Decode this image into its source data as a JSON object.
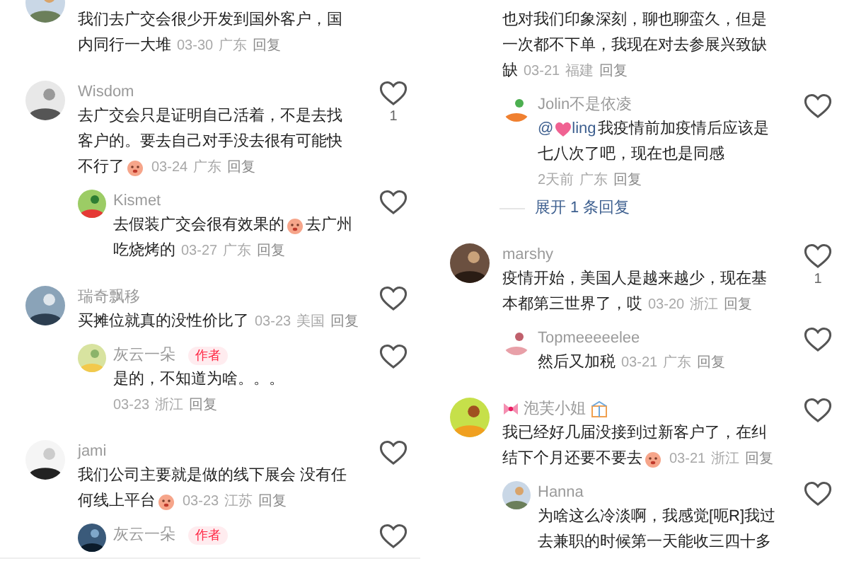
{
  "columns": [
    {
      "divider_at_end": true,
      "comments": [
        {
          "avatar": {
            "kind": "picture"
          },
          "lines": [
            [
              {
                "kind": "text",
                "text": "我们去广交会很少开发到国外客户，国"
              }
            ],
            [
              {
                "kind": "text",
                "text": "内同行一大堆"
              }
            ]
          ],
          "date": "03-30",
          "location": "广东",
          "reply": "回复"
        },
        {
          "avatar": {
            "kind": "picture"
          },
          "name": "Wisdom",
          "lines": [
            [
              {
                "kind": "text",
                "text": "去广交会只是证明自己活着，不是去找"
              }
            ],
            [
              {
                "kind": "text",
                "text": "客户的。要去自己对手没去很有可能快"
              }
            ],
            [
              {
                "kind": "text",
                "text": "不行了"
              },
              {
                "kind": "emoji"
              }
            ]
          ],
          "date": "03-24",
          "location": "广东",
          "reply": "回复",
          "liked": false,
          "likes": "1",
          "replies": [
            {
              "avatar": {
                "kind": "picture"
              },
              "name": "Kismet",
              "lines": [
                [
                  {
                    "kind": "text",
                    "text": "去假装广交会很有效果的"
                  },
                  {
                    "kind": "emoji"
                  },
                  {
                    "kind": "text",
                    "text": "去广州"
                  }
                ],
                [
                  {
                    "kind": "text",
                    "text": "吃烧烤的"
                  }
                ]
              ],
              "date": "03-27",
              "location": "广东",
              "reply": "回复",
              "liked": false
            }
          ]
        },
        {
          "avatar": {
            "kind": "picture"
          },
          "name": "瑞奇飘移",
          "lines": [
            [
              {
                "kind": "text",
                "text": "买摊位就真的没性价比了"
              }
            ]
          ],
          "date": "03-23",
          "location": "美国",
          "reply": "回复",
          "liked": false,
          "replies": [
            {
              "avatar": {
                "kind": "picture"
              },
              "name": "灰云一朵",
              "author_tag": "作者",
              "lines": [
                [
                  {
                    "kind": "text",
                    "text": "是的，不知道为啥。。。"
                  }
                ]
              ],
              "date": "03-23",
              "location": "浙江",
              "reply": "回复",
              "meta_own_line": true,
              "liked": false
            }
          ]
        },
        {
          "avatar": {
            "kind": "picture"
          },
          "name": "jami",
          "lines": [
            [
              {
                "kind": "text",
                "text": "我们公司主要就是做的线下展会 没有任"
              }
            ],
            [
              {
                "kind": "text",
                "text": "何线上平台"
              },
              {
                "kind": "emoji"
              }
            ]
          ],
          "date": "03-23",
          "location": "江苏",
          "reply": "回复",
          "liked": false,
          "replies": [
            {
              "avatar": {
                "kind": "picture"
              },
              "name": "灰云一朵",
              "author_tag": "作者",
              "liked": false
            }
          ]
        }
      ]
    },
    {
      "comments": [
        {
          "lines": [
            [
              {
                "kind": "text",
                "text": "也对我们印象深刻，聊也聊蛮久，但是"
              }
            ],
            [
              {
                "kind": "text",
                "text": "一次都不下单，我现在对去参展兴致缺"
              }
            ],
            [
              {
                "kind": "text",
                "text": "缺"
              }
            ]
          ],
          "date": "03-21",
          "location": "福建",
          "reply": "回复",
          "more_replies": "展开 1 条回复",
          "replies": [
            {
              "avatar": {
                "kind": "picture"
              },
              "name": "Jolin不是依凌",
              "lines": [
                [
                  {
                    "kind": "mention",
                    "text": "@"
                  },
                  {
                    "kind": "heart"
                  },
                  {
                    "kind": "mention",
                    "text": "ling"
                  },
                  {
                    "kind": "text",
                    "text": "我疫情前加疫情后应该是"
                  }
                ],
                [
                  {
                    "kind": "text",
                    "text": "七八次了吧，现在也是同感"
                  }
                ]
              ],
              "date": "2天前",
              "location": "广东",
              "reply": "回复",
              "meta_own_line": true,
              "liked": false
            }
          ]
        },
        {
          "avatar": {
            "kind": "picture"
          },
          "name": "marshy",
          "lines": [
            [
              {
                "kind": "text",
                "text": "疫情开始，美国人是越来越少，现在基"
              }
            ],
            [
              {
                "kind": "text",
                "text": "本都第三世界了，哎"
              }
            ]
          ],
          "date": "03-20",
          "location": "浙江",
          "reply": "回复",
          "liked": false,
          "likes": "1",
          "replies": [
            {
              "avatar": {
                "kind": "picture"
              },
              "name": "Topmeeeeelee",
              "lines": [
                [
                  {
                    "kind": "text",
                    "text": "然后又加税"
                  }
                ]
              ],
              "date": "03-21",
              "location": "广东",
              "reply": "回复",
              "liked": false
            }
          ]
        },
        {
          "avatar": {
            "kind": "picture"
          },
          "name": "泡芙小姐",
          "decorated": true,
          "lines": [
            [
              {
                "kind": "text",
                "text": "我已经好几届没接到过新客户了，在纠"
              }
            ],
            [
              {
                "kind": "text",
                "text": "结下个月还要不要去"
              },
              {
                "kind": "emoji"
              }
            ]
          ],
          "date": "03-21",
          "location": "浙江",
          "reply": "回复",
          "liked": false,
          "replies": [
            {
              "avatar": {
                "kind": "picture"
              },
              "name": "Hanna",
              "lines": [
                [
                  {
                    "kind": "text",
                    "text": "为啥这么冷淡啊，我感觉[呃R]我过"
                  }
                ],
                [
                  {
                    "kind": "text",
                    "text": "去兼职的时候第一天能收三四十多"
                  }
                ]
              ],
              "liked": false
            }
          ]
        }
      ]
    }
  ]
}
